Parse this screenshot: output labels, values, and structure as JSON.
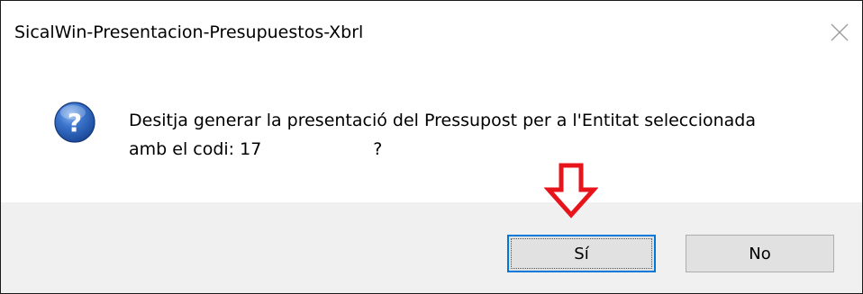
{
  "window": {
    "title": "SicalWin-Presentacion-Presupuestos-Xbrl"
  },
  "message": {
    "line1": "Desitja generar la presentació del Pressupost per a l'Entitat seleccionada",
    "line2_prefix": "amb el codi: 17",
    "line2_suffix": "?"
  },
  "buttons": {
    "yes_label": "Sí",
    "no_label": "No"
  },
  "icons": {
    "dialog_icon": "question-icon",
    "annotation": "red-down-arrow"
  },
  "colors": {
    "button_bar": "#f0f0f0",
    "focus_border": "#0078d7",
    "annotation_arrow": "#e8141b",
    "icon_blue": "#2a62b8"
  }
}
